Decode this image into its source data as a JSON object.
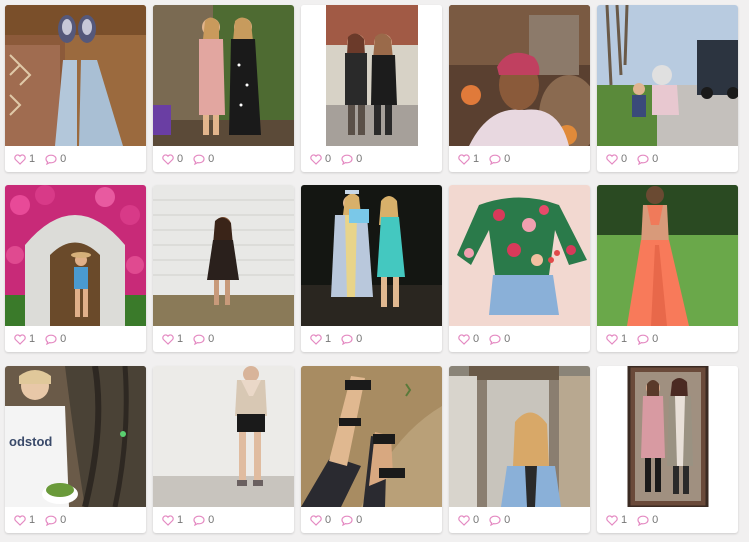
{
  "accent_color": "#e48ac2",
  "cards": [
    {
      "likes": "1",
      "comments": "0",
      "photo": "sneakers-on-rug"
    },
    {
      "likes": "0",
      "comments": "0",
      "photo": "two-women-garden"
    },
    {
      "likes": "0",
      "comments": "0",
      "photo": "two-women-brick-wall"
    },
    {
      "likes": "1",
      "comments": "0",
      "photo": "selfie-couch"
    },
    {
      "likes": "0",
      "comments": "0",
      "photo": "children-street"
    },
    {
      "likes": "1",
      "comments": "0",
      "photo": "flower-arch-doorway"
    },
    {
      "likes": "1",
      "comments": "0",
      "photo": "woman-white-brick"
    },
    {
      "likes": "1",
      "comments": "0",
      "photo": "graduation-night"
    },
    {
      "likes": "0",
      "comments": "0",
      "photo": "floral-top-shorts"
    },
    {
      "likes": "1",
      "comments": "0",
      "photo": "orange-dress-back"
    },
    {
      "likes": "1",
      "comments": "0",
      "photo": "woman-tree-salad"
    },
    {
      "likes": "1",
      "comments": "0",
      "photo": "sweater-shorts"
    },
    {
      "likes": "0",
      "comments": "0",
      "photo": "black-sandals"
    },
    {
      "likes": "0",
      "comments": "0",
      "photo": "chinatown-gate"
    },
    {
      "likes": "1",
      "comments": "0",
      "photo": "two-women-mirror"
    }
  ]
}
